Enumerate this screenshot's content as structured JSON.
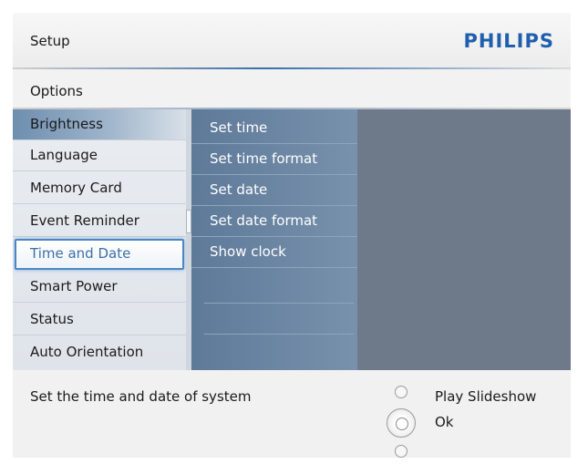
{
  "header": {
    "title": "Setup",
    "brand": "PHILIPS"
  },
  "options_bar": {
    "label": "Options"
  },
  "left_menu": {
    "items": [
      {
        "label": "Brightness"
      },
      {
        "label": "Language"
      },
      {
        "label": "Memory Card"
      },
      {
        "label": "Event Reminder"
      },
      {
        "label": "Time and Date"
      },
      {
        "label": "Smart Power"
      },
      {
        "label": "Status"
      },
      {
        "label": "Auto Orientation"
      }
    ],
    "selected": "Time and Date"
  },
  "sub_menu": {
    "items": [
      {
        "label": "Set time"
      },
      {
        "label": "Set time format"
      },
      {
        "label": "Set date"
      },
      {
        "label": "Set date format"
      },
      {
        "label": "Show clock"
      }
    ]
  },
  "footer": {
    "description": "Set the time and date of system",
    "play_label": "Play Slideshow",
    "ok_label": "Ok"
  },
  "colors": {
    "brand": "#1f5fae",
    "selected_border": "#4b87c7",
    "submenu_bg": "#6b86a3",
    "content_bg": "#6e7a8a"
  },
  "icons": [
    "nav-up-icon",
    "ok-button-icon",
    "nav-down-icon"
  ]
}
